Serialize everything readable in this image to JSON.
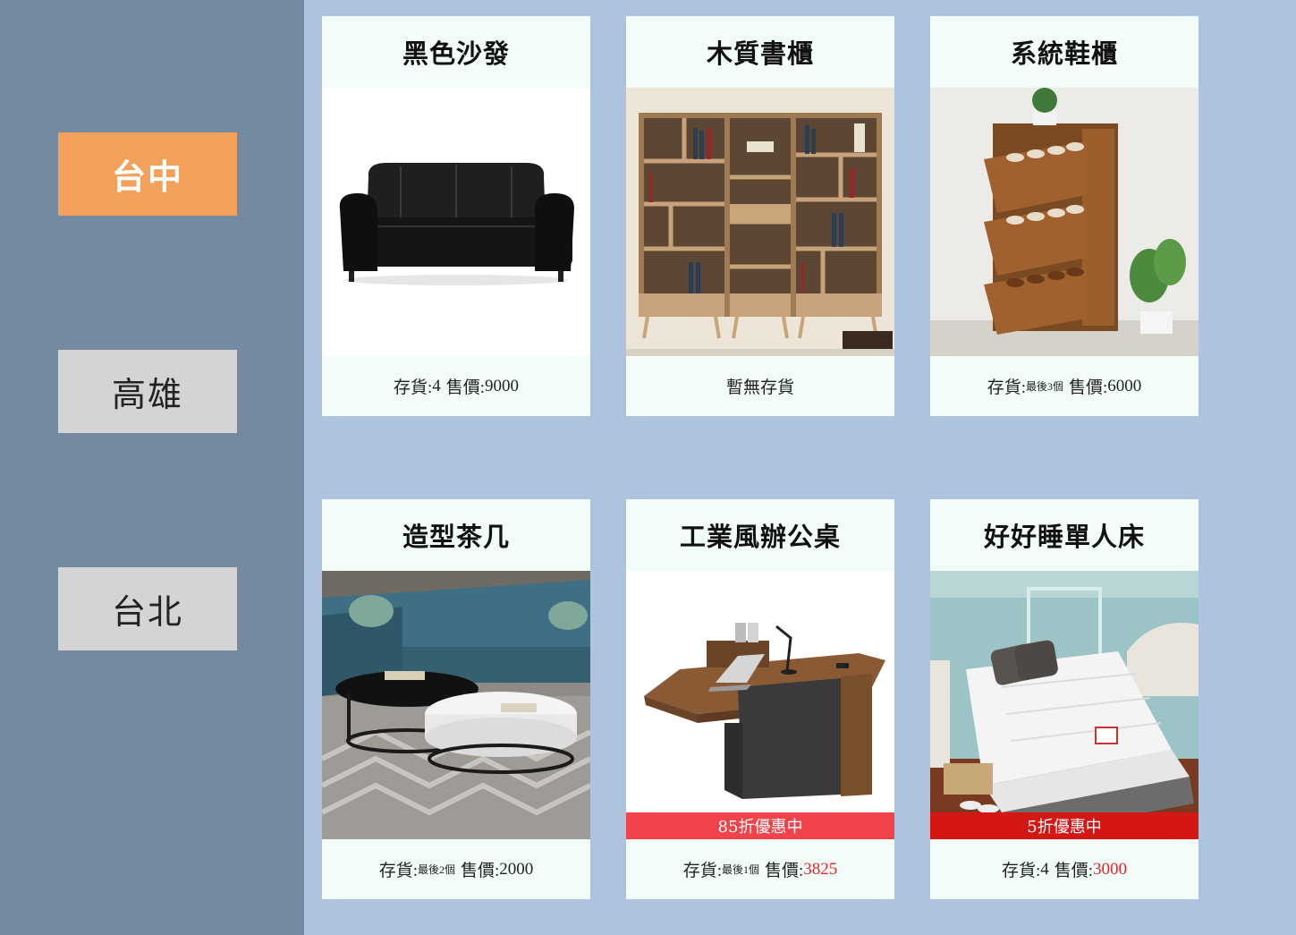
{
  "sidebar": {
    "cities": [
      {
        "label": "台中",
        "active": true
      },
      {
        "label": "高雄",
        "active": false
      },
      {
        "label": "台北",
        "active": false
      }
    ]
  },
  "products": [
    {
      "name": "黑色沙發",
      "stock_label": "存貨:",
      "stock": "4",
      "price_label": "售價:",
      "price": "9000",
      "discount": ""
    },
    {
      "name": "木質書櫃",
      "status": "暫無存貨",
      "discount": ""
    },
    {
      "name": "系統鞋櫃",
      "stock_label": "存貨:",
      "stock_note": "最後3個",
      "price_label": "售價:",
      "price": "6000",
      "discount": ""
    },
    {
      "name": "造型茶几",
      "stock_label": "存貨:",
      "stock_note": "最後2個",
      "price_label": "售價:",
      "price": "2000",
      "discount": ""
    },
    {
      "name": "工業風辦公桌",
      "stock_label": "存貨:",
      "stock_note": "最後1個",
      "price_label": "售價:",
      "price": "3825",
      "discount": "85折優惠中"
    },
    {
      "name": "好好睡單人床",
      "stock_label": "存貨:",
      "stock": "4",
      "price_label": "售價:",
      "price": "3000",
      "discount": "5折優惠中"
    }
  ],
  "colors": {
    "main_bg": "#aec3dd",
    "sidebar_bg": "#738aa0",
    "active_city": "#f3a15a",
    "inactive_city": "#d4d4d4",
    "card_bg": "#f3fdf7",
    "discount_price": "#e8232a"
  },
  "images": [
    "black-sofa-photo",
    "wooden-bookshelf-photo",
    "shoe-cabinet-photo",
    "coffee-table-photo",
    "office-desk-photo",
    "single-bed-photo"
  ]
}
